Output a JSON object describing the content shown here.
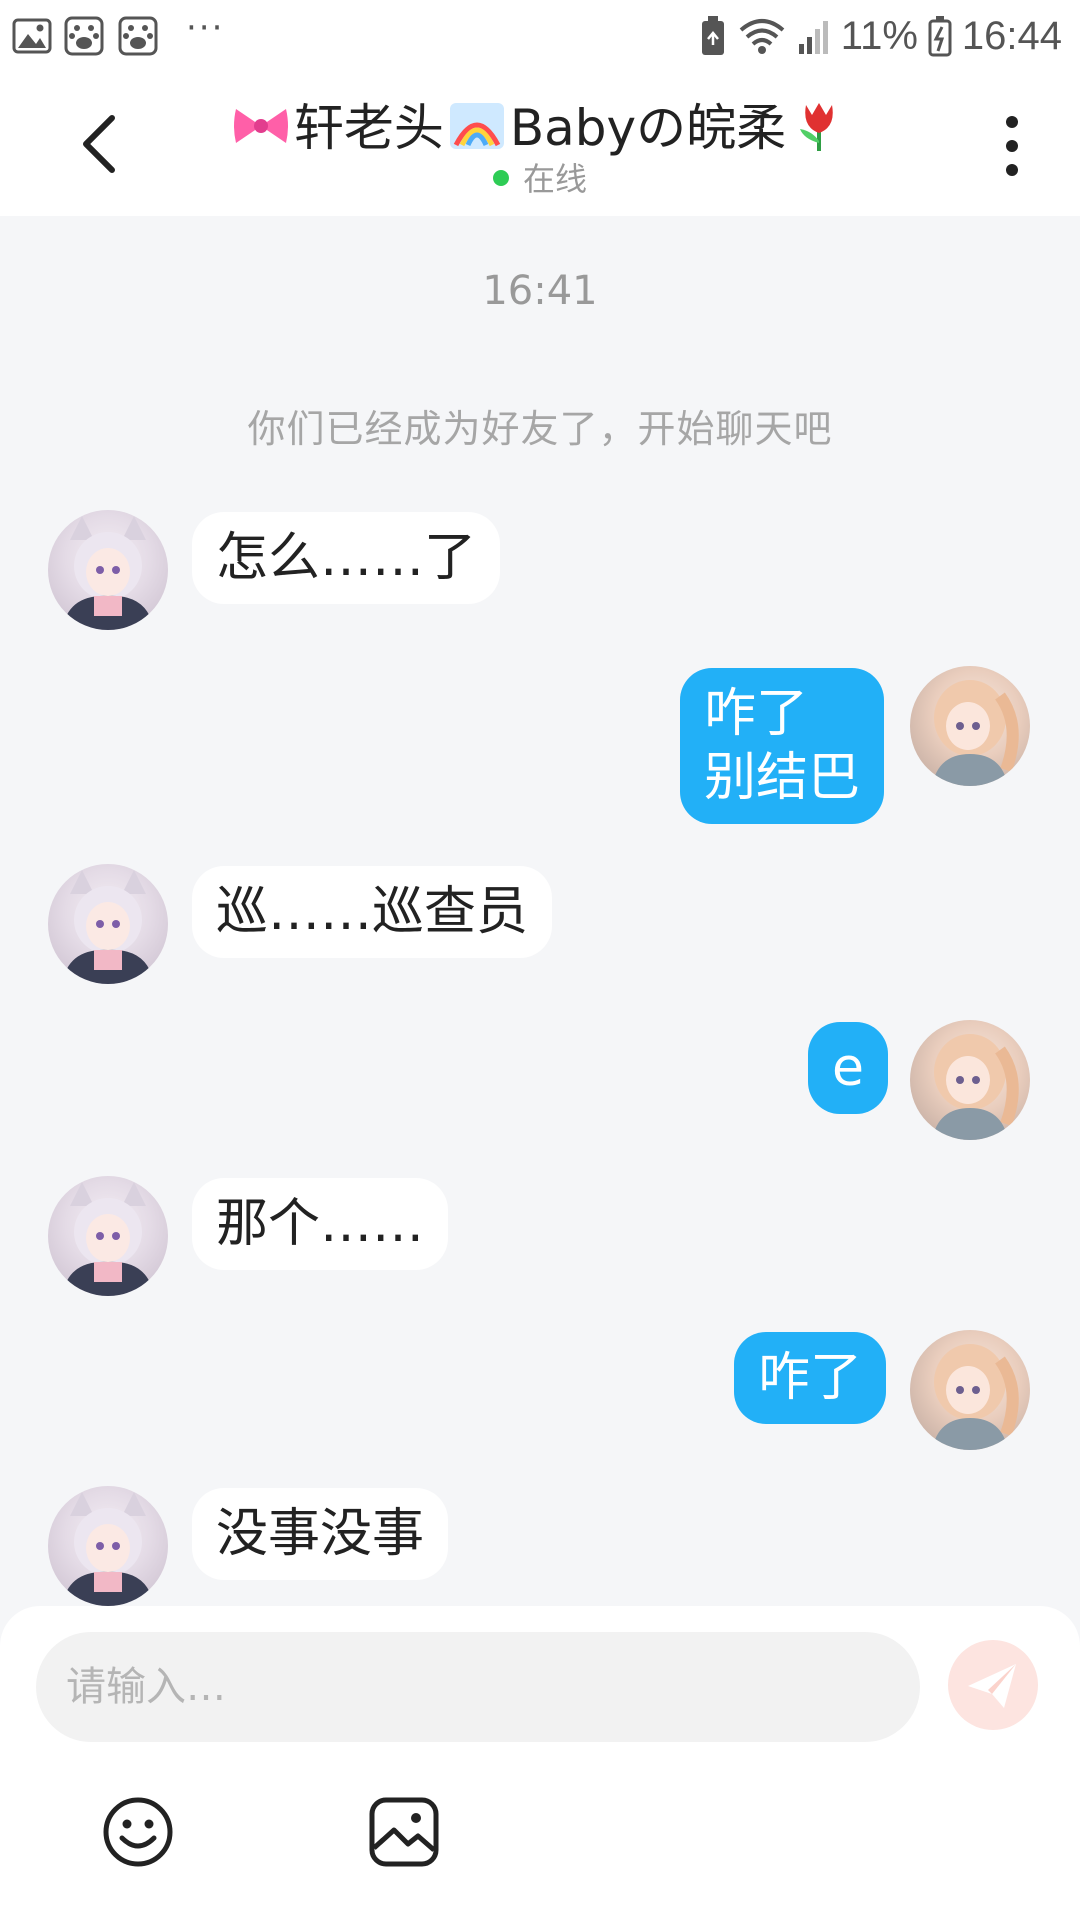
{
  "status_bar": {
    "battery_percent": "11%",
    "time": "16:44",
    "icons": [
      "image-icon",
      "baidu-paw-icon",
      "baidu-paw-icon",
      "more-notifications-icon",
      "battery-saver-icon",
      "wifi-icon",
      "signal-icon",
      "battery-icon"
    ]
  },
  "header": {
    "title_part1": "轩老头",
    "title_part2": "Babyの皖柔",
    "title_emojis": [
      "ribbon-emoji",
      "rainbow-emoji",
      "tulip-emoji"
    ],
    "presence": "在线",
    "presence_color": "#2ecc55"
  },
  "chat": {
    "time_label": "16:41",
    "system_message": "你们已经成为好友了，开始聊天吧",
    "messages": [
      {
        "side": "left",
        "text": "怎么……了"
      },
      {
        "side": "right",
        "line1": "咋了",
        "line2": "别结巴"
      },
      {
        "side": "left",
        "text": "巡……巡查员"
      },
      {
        "side": "right",
        "text": "e"
      },
      {
        "side": "left",
        "text": "那个……"
      },
      {
        "side": "right",
        "text": "咋了"
      },
      {
        "side": "left",
        "text": "没事没事"
      }
    ]
  },
  "composer": {
    "placeholder": "请输入…",
    "send_icon": "paper-plane-icon",
    "tools": [
      "emoji-icon",
      "image-icon"
    ]
  },
  "colors": {
    "accent": "#22b0f7",
    "send_button_bg": "#fde4e0",
    "chat_bg": "#f5f6f8"
  }
}
